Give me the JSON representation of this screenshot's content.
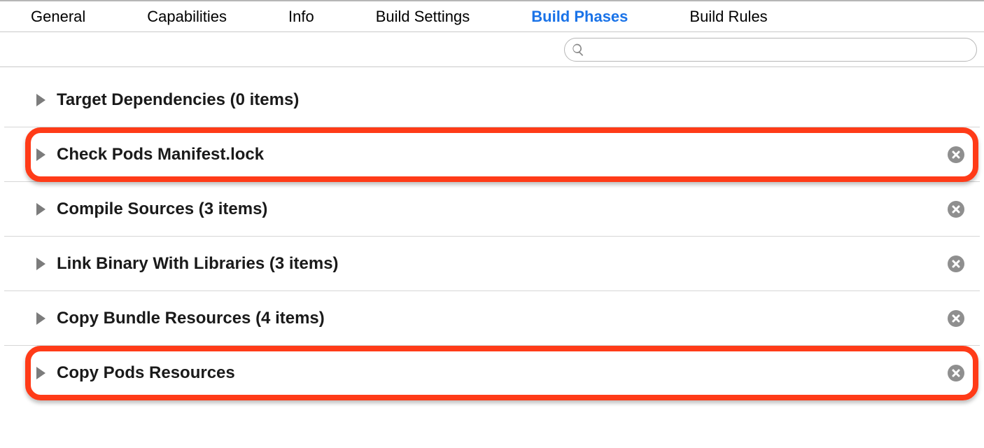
{
  "tabs": {
    "items": [
      {
        "label": "General",
        "active": false
      },
      {
        "label": "Capabilities",
        "active": false
      },
      {
        "label": "Info",
        "active": false
      },
      {
        "label": "Build Settings",
        "active": false
      },
      {
        "label": "Build Phases",
        "active": true
      },
      {
        "label": "Build Rules",
        "active": false
      }
    ]
  },
  "search": {
    "placeholder": ""
  },
  "phases": [
    {
      "title": "Target Dependencies (0 items)",
      "closable": false,
      "highlighted": false
    },
    {
      "title": "Check Pods Manifest.lock",
      "closable": true,
      "highlighted": true
    },
    {
      "title": "Compile Sources (3 items)",
      "closable": true,
      "highlighted": false
    },
    {
      "title": "Link Binary With Libraries (3 items)",
      "closable": true,
      "highlighted": false
    },
    {
      "title": "Copy Bundle Resources (4 items)",
      "closable": true,
      "highlighted": false
    },
    {
      "title": "Copy Pods Resources",
      "closable": true,
      "highlighted": true
    }
  ]
}
